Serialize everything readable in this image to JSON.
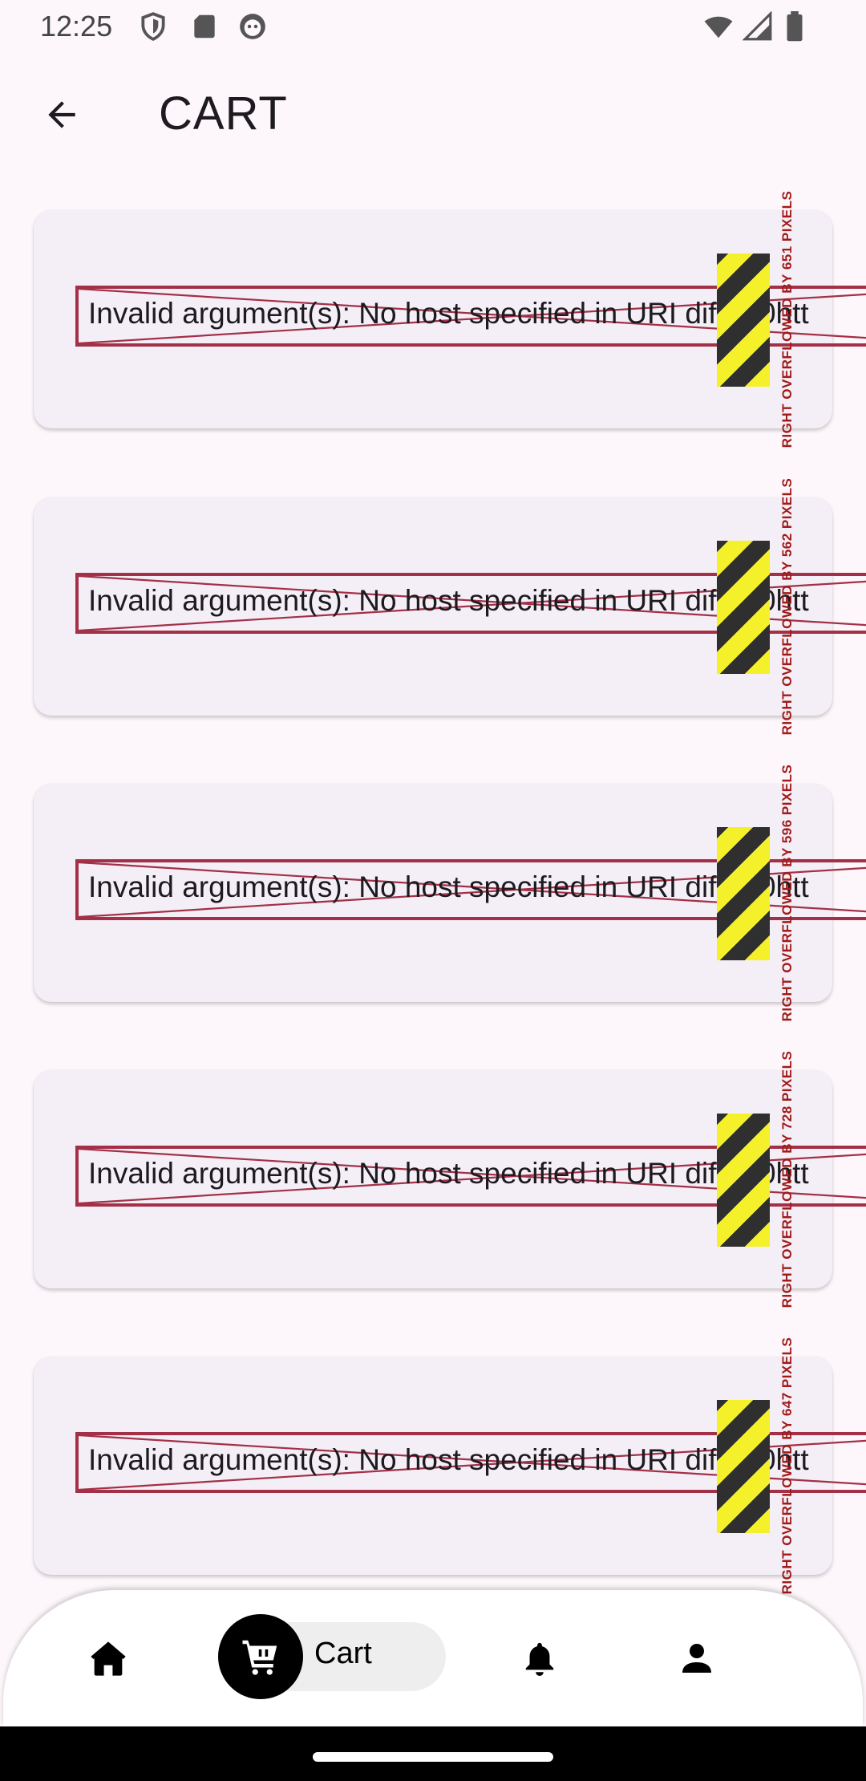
{
  "status_bar": {
    "time": "12:25",
    "left_icons": [
      "shield-icon",
      "sd-card-icon",
      "android-debug-icon"
    ],
    "right_icons": [
      "wifi-icon",
      "cell-signal-icon",
      "battery-icon"
    ]
  },
  "app_bar": {
    "title": "CART",
    "back_icon": "arrow-left-icon"
  },
  "cart_items": [
    {
      "error_text": "Invalid argument(s): No host specified in URI dif%20htt",
      "overflow_text": "RIGHT OVERFLOWED BY 651 PIXELS"
    },
    {
      "error_text": "Invalid argument(s): No host specified in URI dif%20htt",
      "overflow_text": "RIGHT OVERFLOWED BY 562 PIXELS"
    },
    {
      "error_text": "Invalid argument(s): No host specified in URI dif%20htt",
      "overflow_text": "RIGHT OVERFLOWED BY 596 PIXELS"
    },
    {
      "error_text": "Invalid argument(s): No host specified in URI dif%20htt",
      "overflow_text": "RIGHT OVERFLOWED BY 728 PIXELS"
    },
    {
      "error_text": "Invalid argument(s): No host specified in URI dif%20htt",
      "overflow_text": "RIGHT OVERFLOWED BY 647 PIXELS"
    }
  ],
  "bottom_nav": {
    "items": [
      {
        "icon": "home-icon",
        "label": ""
      },
      {
        "icon": "cart-icon",
        "label": "Cart",
        "selected": true
      },
      {
        "icon": "bell-icon",
        "label": ""
      },
      {
        "icon": "person-icon",
        "label": ""
      }
    ]
  },
  "colors": {
    "background": "#fdf7fb",
    "card": "#f4eff6",
    "error_border": "#a33047",
    "overflow_text": "#a01a1a",
    "hazard_yellow": "#f4f02a",
    "hazard_dark": "#2f2f2f"
  }
}
